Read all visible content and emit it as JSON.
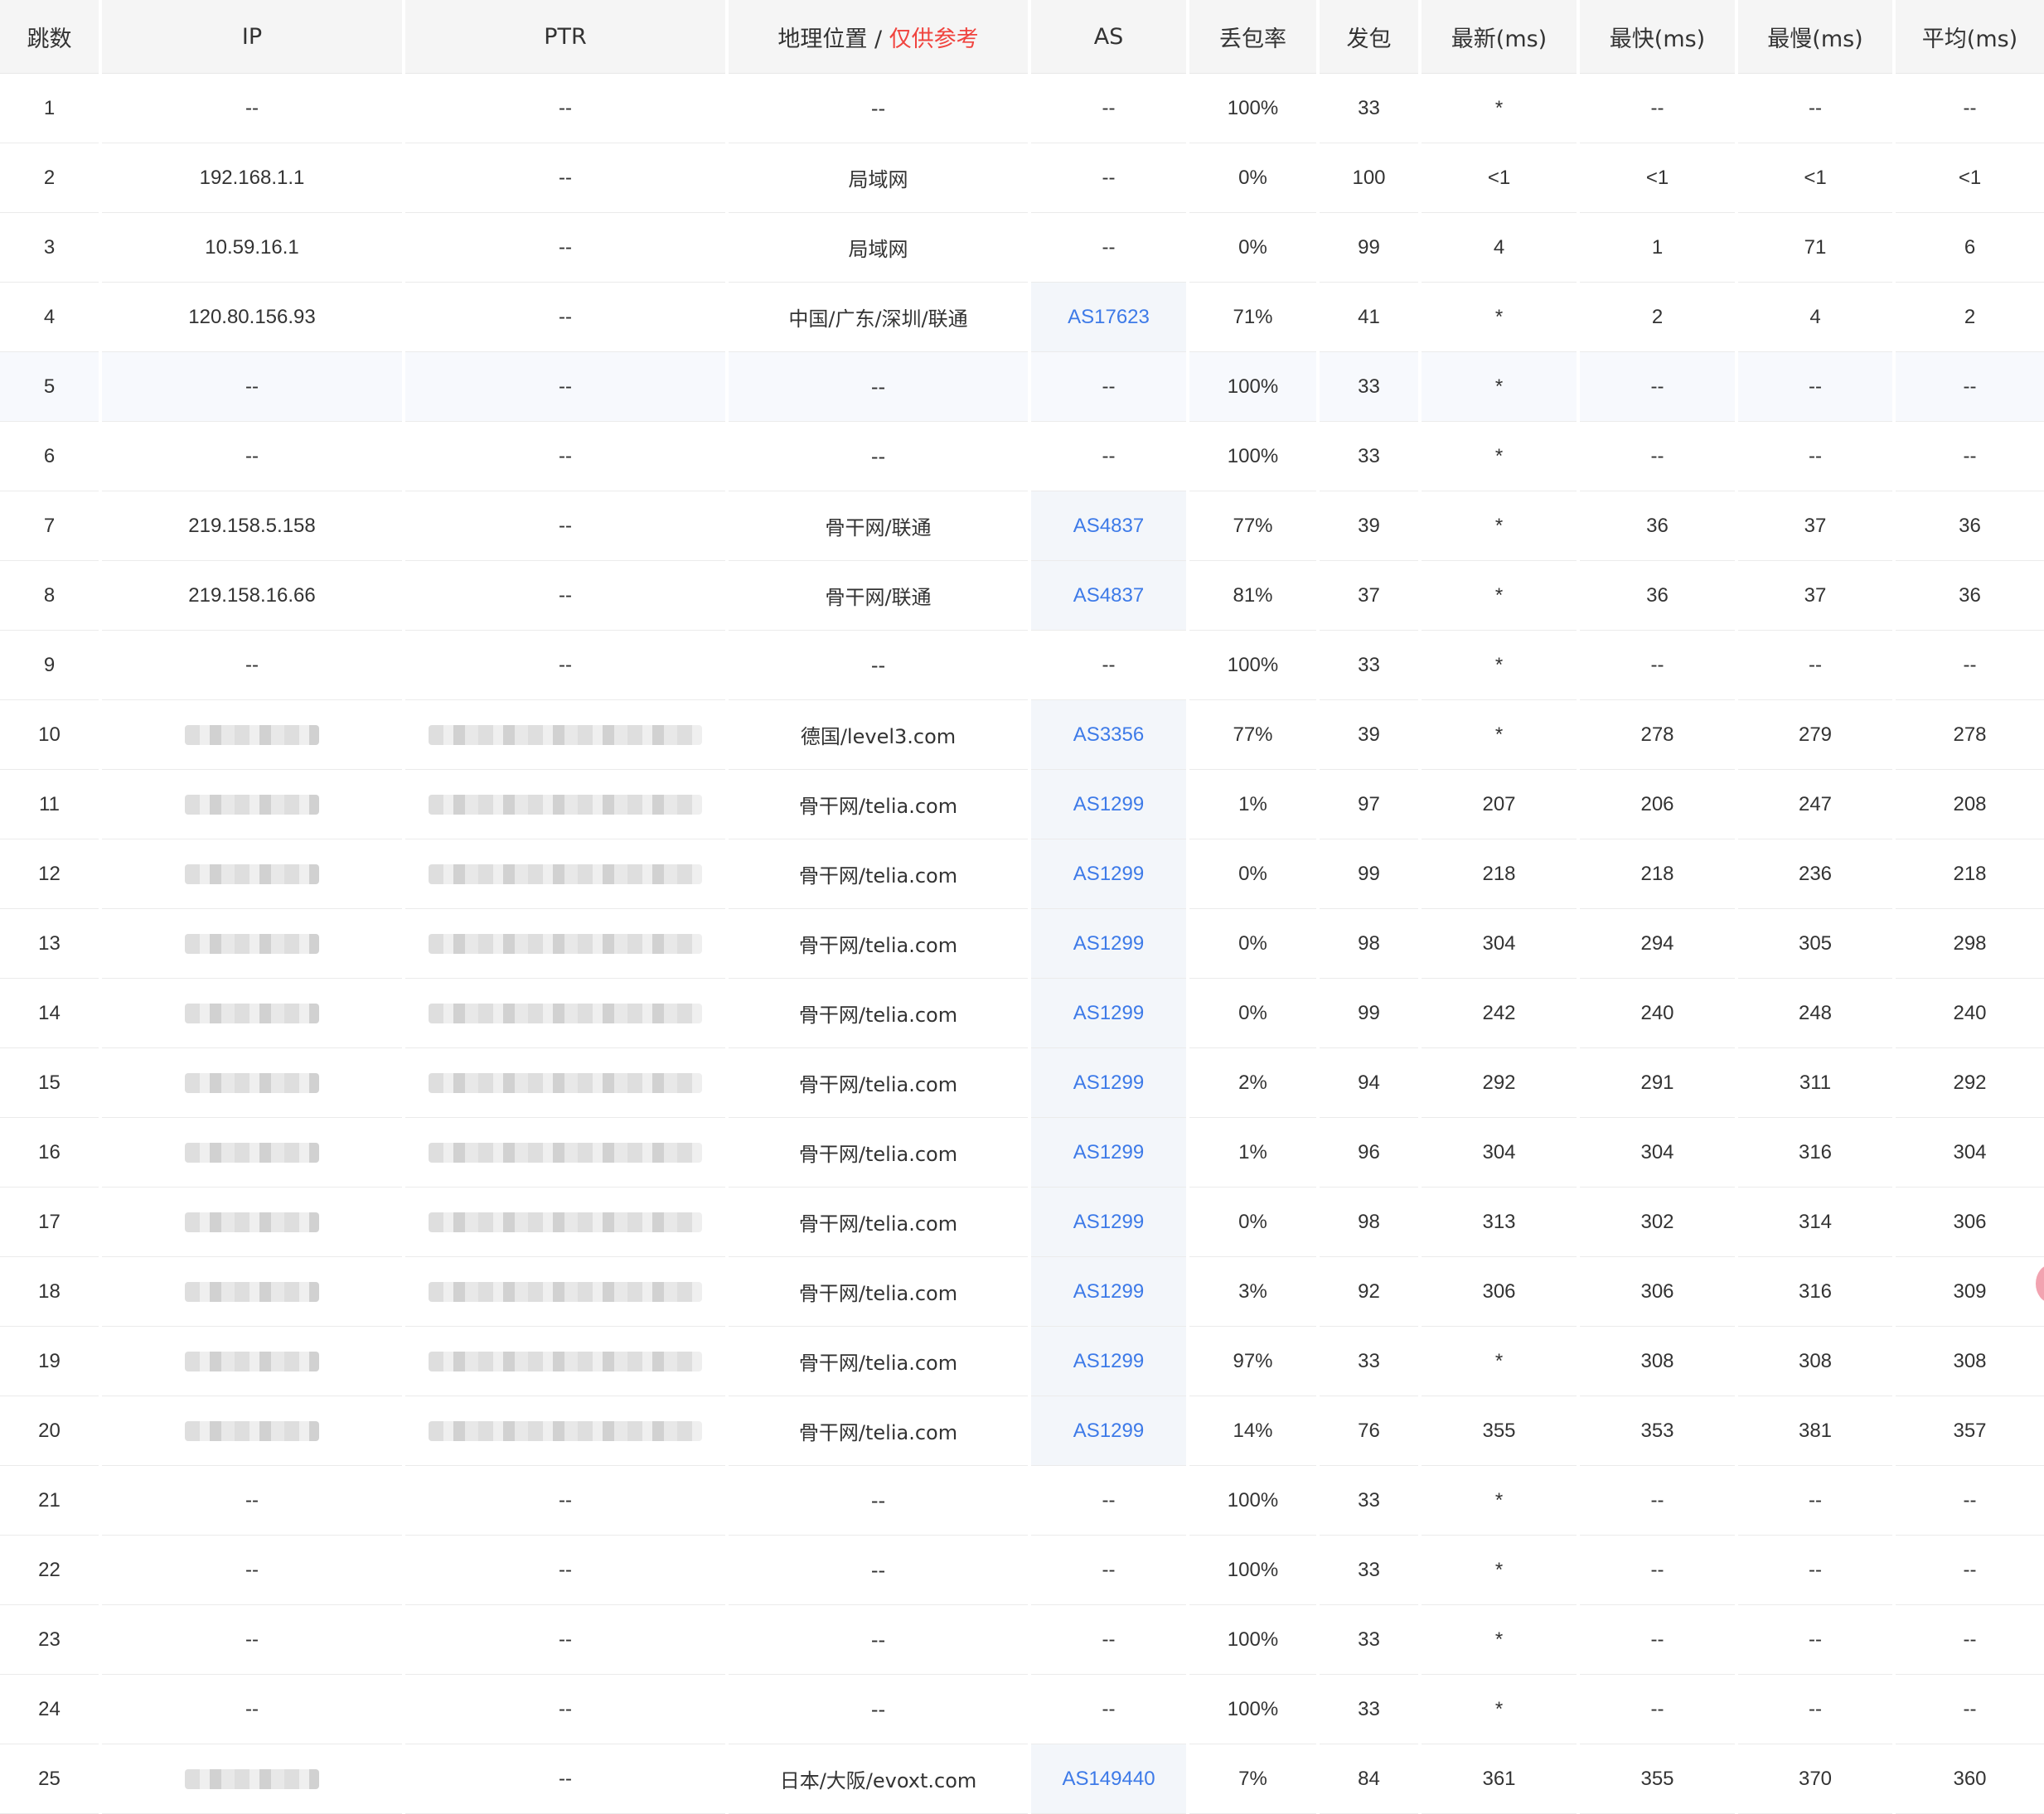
{
  "headers": {
    "hop": "跳数",
    "ip": "IP",
    "ptr": "PTR",
    "geo_prefix": "地理位置 / ",
    "geo_hint": "仅供参考",
    "as": "AS",
    "loss": "丢包率",
    "sent": "发包",
    "last": "最新(ms)",
    "best": "最快(ms)",
    "worst": "最慢(ms)",
    "avg": "平均(ms)"
  },
  "colors": {
    "as_link": "#3d7ae8",
    "geo_hint": "#f0433e",
    "header_bg": "#f5f5f5",
    "highlight_row_bg": "#f7f9fd"
  },
  "highlighted_hop": "5",
  "rows": [
    {
      "hop": "1",
      "ip": "--",
      "ptr": "--",
      "geo": "--",
      "as": "--",
      "loss": "100%",
      "sent": "33",
      "last": "*",
      "best": "--",
      "worst": "--",
      "avg": "--"
    },
    {
      "hop": "2",
      "ip": "192.168.1.1",
      "ptr": "--",
      "geo": "局域网",
      "as": "--",
      "loss": "0%",
      "sent": "100",
      "last": "<1",
      "best": "<1",
      "worst": "<1",
      "avg": "<1"
    },
    {
      "hop": "3",
      "ip": "10.59.16.1",
      "ptr": "--",
      "geo": "局域网",
      "as": "--",
      "loss": "0%",
      "sent": "99",
      "last": "4",
      "best": "1",
      "worst": "71",
      "avg": "6"
    },
    {
      "hop": "4",
      "ip": "120.80.156.93",
      "ptr": "--",
      "geo": "中国/广东/深圳/联通",
      "as": "AS17623",
      "loss": "71%",
      "sent": "41",
      "last": "*",
      "best": "2",
      "worst": "4",
      "avg": "2"
    },
    {
      "hop": "5",
      "ip": "--",
      "ptr": "--",
      "geo": "--",
      "as": "--",
      "loss": "100%",
      "sent": "33",
      "last": "*",
      "best": "--",
      "worst": "--",
      "avg": "--"
    },
    {
      "hop": "6",
      "ip": "--",
      "ptr": "--",
      "geo": "--",
      "as": "--",
      "loss": "100%",
      "sent": "33",
      "last": "*",
      "best": "--",
      "worst": "--",
      "avg": "--"
    },
    {
      "hop": "7",
      "ip": "219.158.5.158",
      "ptr": "--",
      "geo": "骨干网/联通",
      "as": "AS4837",
      "loss": "77%",
      "sent": "39",
      "last": "*",
      "best": "36",
      "worst": "37",
      "avg": "36"
    },
    {
      "hop": "8",
      "ip": "219.158.16.66",
      "ptr": "--",
      "geo": "骨干网/联通",
      "as": "AS4837",
      "loss": "81%",
      "sent": "37",
      "last": "*",
      "best": "36",
      "worst": "37",
      "avg": "36"
    },
    {
      "hop": "9",
      "ip": "--",
      "ptr": "--",
      "geo": "--",
      "as": "--",
      "loss": "100%",
      "sent": "33",
      "last": "*",
      "best": "--",
      "worst": "--",
      "avg": "--"
    },
    {
      "hop": "10",
      "ip": null,
      "ptr": null,
      "geo": "德国/level3.com",
      "as": "AS3356",
      "loss": "77%",
      "sent": "39",
      "last": "*",
      "best": "278",
      "worst": "279",
      "avg": "278"
    },
    {
      "hop": "11",
      "ip": null,
      "ptr": null,
      "geo": "骨干网/telia.com",
      "as": "AS1299",
      "loss": "1%",
      "sent": "97",
      "last": "207",
      "best": "206",
      "worst": "247",
      "avg": "208"
    },
    {
      "hop": "12",
      "ip": null,
      "ptr": null,
      "geo": "骨干网/telia.com",
      "as": "AS1299",
      "loss": "0%",
      "sent": "99",
      "last": "218",
      "best": "218",
      "worst": "236",
      "avg": "218"
    },
    {
      "hop": "13",
      "ip": null,
      "ptr": null,
      "geo": "骨干网/telia.com",
      "as": "AS1299",
      "loss": "0%",
      "sent": "98",
      "last": "304",
      "best": "294",
      "worst": "305",
      "avg": "298"
    },
    {
      "hop": "14",
      "ip": null,
      "ptr": null,
      "geo": "骨干网/telia.com",
      "as": "AS1299",
      "loss": "0%",
      "sent": "99",
      "last": "242",
      "best": "240",
      "worst": "248",
      "avg": "240"
    },
    {
      "hop": "15",
      "ip": null,
      "ptr": null,
      "geo": "骨干网/telia.com",
      "as": "AS1299",
      "loss": "2%",
      "sent": "94",
      "last": "292",
      "best": "291",
      "worst": "311",
      "avg": "292"
    },
    {
      "hop": "16",
      "ip": null,
      "ptr": null,
      "geo": "骨干网/telia.com",
      "as": "AS1299",
      "loss": "1%",
      "sent": "96",
      "last": "304",
      "best": "304",
      "worst": "316",
      "avg": "304"
    },
    {
      "hop": "17",
      "ip": null,
      "ptr": null,
      "geo": "骨干网/telia.com",
      "as": "AS1299",
      "loss": "0%",
      "sent": "98",
      "last": "313",
      "best": "302",
      "worst": "314",
      "avg": "306"
    },
    {
      "hop": "18",
      "ip": null,
      "ptr": null,
      "geo": "骨干网/telia.com",
      "as": "AS1299",
      "loss": "3%",
      "sent": "92",
      "last": "306",
      "best": "306",
      "worst": "316",
      "avg": "309"
    },
    {
      "hop": "19",
      "ip": null,
      "ptr": null,
      "geo": "骨干网/telia.com",
      "as": "AS1299",
      "loss": "97%",
      "sent": "33",
      "last": "*",
      "best": "308",
      "worst": "308",
      "avg": "308"
    },
    {
      "hop": "20",
      "ip": null,
      "ptr": null,
      "geo": "骨干网/telia.com",
      "as": "AS1299",
      "loss": "14%",
      "sent": "76",
      "last": "355",
      "best": "353",
      "worst": "381",
      "avg": "357"
    },
    {
      "hop": "21",
      "ip": "--",
      "ptr": "--",
      "geo": "--",
      "as": "--",
      "loss": "100%",
      "sent": "33",
      "last": "*",
      "best": "--",
      "worst": "--",
      "avg": "--"
    },
    {
      "hop": "22",
      "ip": "--",
      "ptr": "--",
      "geo": "--",
      "as": "--",
      "loss": "100%",
      "sent": "33",
      "last": "*",
      "best": "--",
      "worst": "--",
      "avg": "--"
    },
    {
      "hop": "23",
      "ip": "--",
      "ptr": "--",
      "geo": "--",
      "as": "--",
      "loss": "100%",
      "sent": "33",
      "last": "*",
      "best": "--",
      "worst": "--",
      "avg": "--"
    },
    {
      "hop": "24",
      "ip": "--",
      "ptr": "--",
      "geo": "--",
      "as": "--",
      "loss": "100%",
      "sent": "33",
      "last": "*",
      "best": "--",
      "worst": "--",
      "avg": "--"
    },
    {
      "hop": "25",
      "ip": null,
      "ptr": "--",
      "geo": "日本/大阪/evoxt.com",
      "as": "AS149440",
      "loss": "7%",
      "sent": "84",
      "last": "361",
      "best": "355",
      "worst": "370",
      "avg": "360"
    }
  ]
}
